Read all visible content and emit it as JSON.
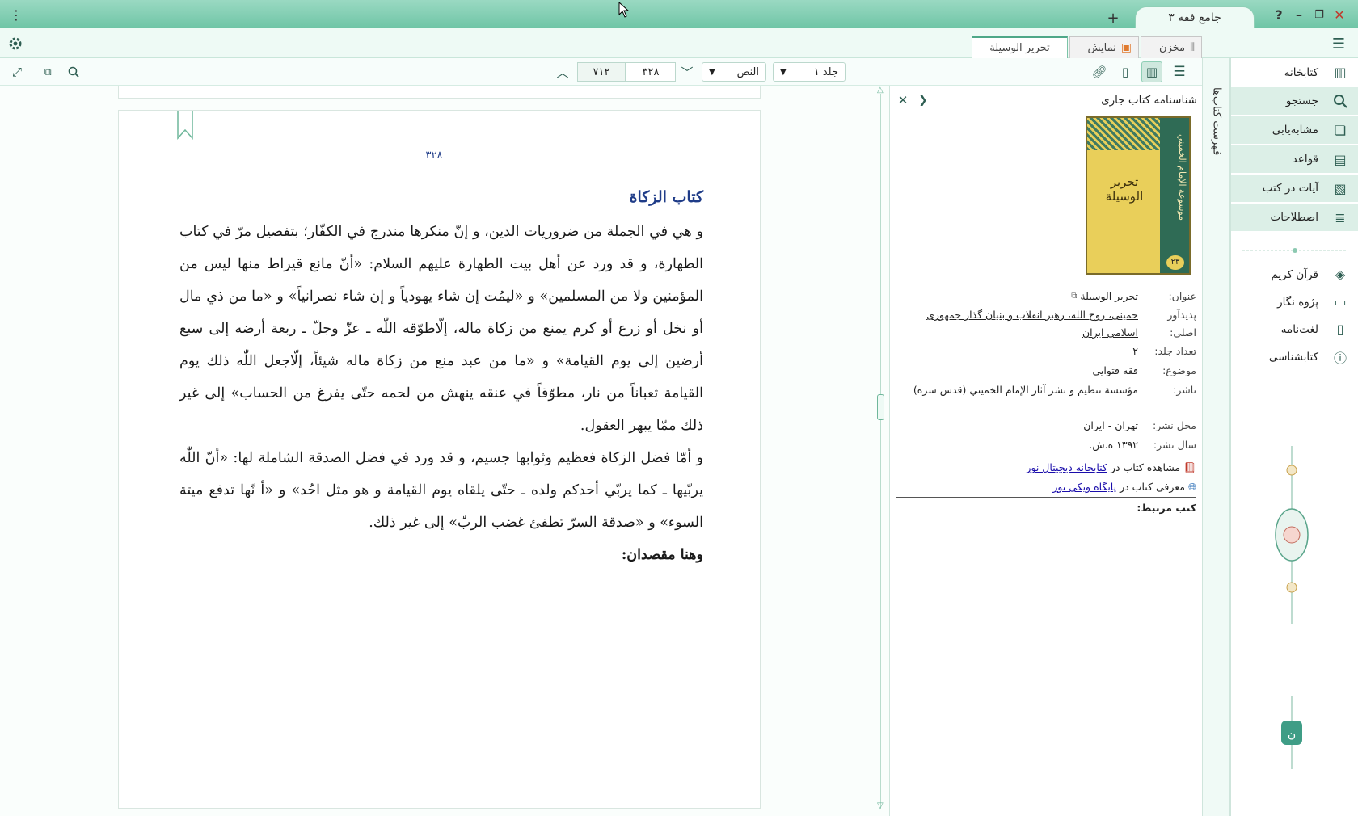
{
  "titlebar": {
    "tab_title": "جامع فقه ۳",
    "help_icon": "?",
    "minimize_icon": "–",
    "restore_icon": "❐",
    "close_icon": "✕",
    "new_tab_icon": "+",
    "menu_icon": "⋮"
  },
  "navbar": {
    "tabs": [
      {
        "label": "مخزن"
      },
      {
        "label": "نمایش"
      },
      {
        "label": "تحرير الوسيلة"
      }
    ]
  },
  "toolbar": {
    "volume": "جلد ۱",
    "section": "النص",
    "page_current": "۳۲۸",
    "page_total": "۷۱۲"
  },
  "sidebar": {
    "items": [
      {
        "label": "کتابخانه",
        "icon": "library-icon"
      },
      {
        "label": "جستجو",
        "icon": "search-icon"
      },
      {
        "label": "مشابه‌یابی",
        "icon": "similar-icon"
      },
      {
        "label": "قواعد",
        "icon": "rules-icon"
      },
      {
        "label": "آیات در کتب",
        "icon": "verses-icon"
      },
      {
        "label": "اصطلاحات",
        "icon": "terms-icon"
      },
      {
        "label": "قرآن کریم",
        "icon": "quran-icon"
      },
      {
        "label": "پژوه نگار",
        "icon": "notes-icon"
      },
      {
        "label": "لغت‌نامه",
        "icon": "dictionary-icon"
      },
      {
        "label": "کتابشناسی",
        "icon": "info-icon"
      }
    ],
    "vertical_label": "فهرست کتاب‌ها"
  },
  "info": {
    "title": "شناسنامه کتاب جاری",
    "cover_title": "تحرير الوسيلة",
    "cover_side": "موسوعة الإمام الخميني",
    "cover_num": "۲۳",
    "rows": {
      "k_title": "عنوان:",
      "v_title": "تحرير الوسيلة",
      "k_author": "پدیدآور اصلی:",
      "v_author": "خمینی، روح الله، رهبر انقلاب و بنیان گذار جمهوری اسلامی ایران",
      "k_volumes": "تعداد جلد:",
      "v_volumes": "۲",
      "k_subject": "موضوع:",
      "v_subject": "فقه فتوایی",
      "k_publisher": "ناشر:",
      "v_publisher": "مؤسسة تنظيم و نشر آثار الإمام الخميني (قدس سره)",
      "k_place": "محل نشر:",
      "v_place": "تهران - ایران",
      "k_year": "سال نشر:",
      "v_year": "۱۳۹۲ ه.ش."
    },
    "link1_prefix": "مشاهده کتاب در",
    "link1": "کتابخانه دیجیتال نور",
    "link2_prefix": "معرفی کتاب در",
    "link2": "پایگاه ویکی نور",
    "related": "کتب مرتبط:"
  },
  "page": {
    "number": "۳۲۸",
    "heading": "كتاب الزكاة",
    "paragraph1": "و هي في الجملة من ضروريات الدين، و إنّ منكرها مندرج في الكفّار؛ بتفصيل مرّ في كتاب الطهارة، و قد ورد عن أهل بيت الطهارة عليهم السلام: «أنّ مانع قيراط منها ليس من المؤمنين ولا من المسلمين» و «ليمُت إن شاء يهودياً و إن شاء نصرانياً» و «ما من ذي مال أو نخل أو زرع أو كرم يمنع من زكاة ماله، إلّاطوّقه اللّٰه ـ عزّ وجلّ ـ ربعة أرضه إلى سبع أرضين إلى يوم القيامة» و «ما من عبد منع من زكاة ماله شيئاً، إلّاجعل اللّٰه ذلك يوم القيامة ثعباناً من نار، مطوّقاً في عنقه ينهش من لحمه حتّى يفرغ من الحساب» إلى غير ذلك ممّا يبهر العقول.",
    "paragraph2": "و أمّا فضل الزكاة فعظيم وثوابها جسيم، و قد ورد في فضل الصدقة الشاملة لها: «أنّ اللّٰه يربّيها ـ كما يربّي أحدكم ولده ـ حتّى يلقاه يوم القيامة و هو مثل احُد» و «أ نّها تدفع ميتة السوء» و «صدقة السرّ تطفئ غضب الربّ» إلى غير ذلك.",
    "subheading": "وهنا مقصدان:"
  },
  "colors": {
    "accent": "#6fc5a6",
    "heading": "#1f3c88",
    "link": "#1a0dab"
  }
}
